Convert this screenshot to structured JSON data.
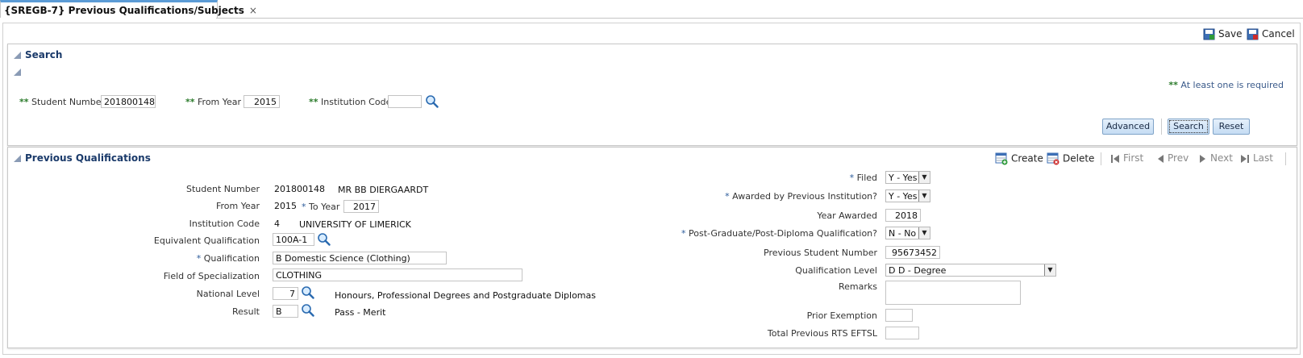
{
  "tab": {
    "title": "{SREGB-7} Previous Qualifications/Subjects",
    "close": "×"
  },
  "toolbar": {
    "save_label": "Save",
    "cancel_label": "Cancel"
  },
  "search": {
    "title": "Search",
    "required_marker": "**",
    "required_note": "At least one is required",
    "student_number_label": "Student Number",
    "student_number": "201800148",
    "from_year_label": "From Year",
    "from_year": "2015",
    "institution_code_label": "Institution Code",
    "institution_code": "",
    "advanced_label": "Advanced",
    "search_label": "Search",
    "reset_label": "Reset"
  },
  "prev": {
    "title": "Previous Qualifications",
    "create_label": "Create",
    "delete_label": "Delete",
    "first_label": "First",
    "prev_label": "Prev",
    "next_label": "Next",
    "last_label": "Last",
    "star": "*",
    "left": {
      "student_number_label": "Student Number",
      "student_number": "201800148",
      "student_name": "MR BB DIERGAARDT",
      "from_year_label": "From Year",
      "from_year": "2015",
      "to_year_label": "To Year",
      "to_year": "2017",
      "institution_code_label": "Institution Code",
      "institution_code": "4",
      "institution_name": "UNIVERSITY OF LIMERICK",
      "equivalent_label": "Equivalent Qualification",
      "equivalent": "100A-1",
      "qualification_label": "Qualification",
      "qualification": "B Domestic Science (Clothing)",
      "field_label": "Field of Specialization",
      "field": "CLOTHING",
      "national_level_label": "National Level",
      "national_level": "7",
      "national_level_desc": "Honours, Professional Degrees and Postgraduate Diplomas",
      "result_label": "Result",
      "result": "B",
      "result_desc": "Pass - Merit"
    },
    "right": {
      "filed_label": "Filed",
      "filed": "Y - Yes",
      "awarded_label": "Awarded by Previous Institution?",
      "awarded": "Y - Yes",
      "year_awarded_label": "Year Awarded",
      "year_awarded": "2018",
      "postgrad_label": "Post-Graduate/Post-Diploma Qualification?",
      "postgrad": "N - No",
      "prev_student_label": "Previous Student Number",
      "prev_student": "95673452",
      "qual_level_label": "Qualification Level",
      "qual_level": "D D - Degree",
      "remarks_label": "Remarks",
      "remarks": "",
      "prior_exemption_label": "Prior Exemption",
      "prior_exemption": "",
      "total_rts_label": "Total Previous RTS EFTSL",
      "total_rts": ""
    }
  }
}
